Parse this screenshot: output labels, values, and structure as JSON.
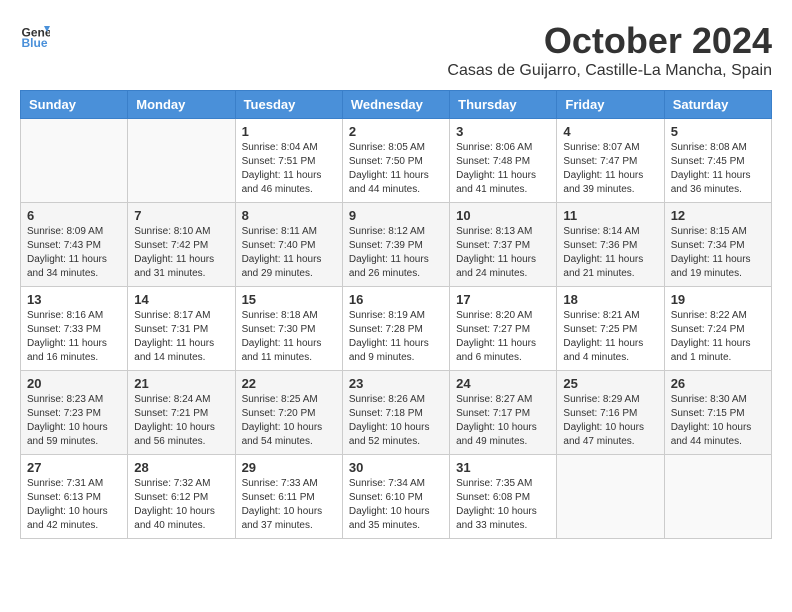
{
  "header": {
    "logo_line1": "General",
    "logo_line2": "Blue",
    "month_year": "October 2024",
    "location": "Casas de Guijarro, Castille-La Mancha, Spain"
  },
  "weekdays": [
    "Sunday",
    "Monday",
    "Tuesday",
    "Wednesday",
    "Thursday",
    "Friday",
    "Saturday"
  ],
  "weeks": [
    [
      {
        "num": "",
        "detail": ""
      },
      {
        "num": "",
        "detail": ""
      },
      {
        "num": "1",
        "detail": "Sunrise: 8:04 AM\nSunset: 7:51 PM\nDaylight: 11 hours and 46 minutes."
      },
      {
        "num": "2",
        "detail": "Sunrise: 8:05 AM\nSunset: 7:50 PM\nDaylight: 11 hours and 44 minutes."
      },
      {
        "num": "3",
        "detail": "Sunrise: 8:06 AM\nSunset: 7:48 PM\nDaylight: 11 hours and 41 minutes."
      },
      {
        "num": "4",
        "detail": "Sunrise: 8:07 AM\nSunset: 7:47 PM\nDaylight: 11 hours and 39 minutes."
      },
      {
        "num": "5",
        "detail": "Sunrise: 8:08 AM\nSunset: 7:45 PM\nDaylight: 11 hours and 36 minutes."
      }
    ],
    [
      {
        "num": "6",
        "detail": "Sunrise: 8:09 AM\nSunset: 7:43 PM\nDaylight: 11 hours and 34 minutes."
      },
      {
        "num": "7",
        "detail": "Sunrise: 8:10 AM\nSunset: 7:42 PM\nDaylight: 11 hours and 31 minutes."
      },
      {
        "num": "8",
        "detail": "Sunrise: 8:11 AM\nSunset: 7:40 PM\nDaylight: 11 hours and 29 minutes."
      },
      {
        "num": "9",
        "detail": "Sunrise: 8:12 AM\nSunset: 7:39 PM\nDaylight: 11 hours and 26 minutes."
      },
      {
        "num": "10",
        "detail": "Sunrise: 8:13 AM\nSunset: 7:37 PM\nDaylight: 11 hours and 24 minutes."
      },
      {
        "num": "11",
        "detail": "Sunrise: 8:14 AM\nSunset: 7:36 PM\nDaylight: 11 hours and 21 minutes."
      },
      {
        "num": "12",
        "detail": "Sunrise: 8:15 AM\nSunset: 7:34 PM\nDaylight: 11 hours and 19 minutes."
      }
    ],
    [
      {
        "num": "13",
        "detail": "Sunrise: 8:16 AM\nSunset: 7:33 PM\nDaylight: 11 hours and 16 minutes."
      },
      {
        "num": "14",
        "detail": "Sunrise: 8:17 AM\nSunset: 7:31 PM\nDaylight: 11 hours and 14 minutes."
      },
      {
        "num": "15",
        "detail": "Sunrise: 8:18 AM\nSunset: 7:30 PM\nDaylight: 11 hours and 11 minutes."
      },
      {
        "num": "16",
        "detail": "Sunrise: 8:19 AM\nSunset: 7:28 PM\nDaylight: 11 hours and 9 minutes."
      },
      {
        "num": "17",
        "detail": "Sunrise: 8:20 AM\nSunset: 7:27 PM\nDaylight: 11 hours and 6 minutes."
      },
      {
        "num": "18",
        "detail": "Sunrise: 8:21 AM\nSunset: 7:25 PM\nDaylight: 11 hours and 4 minutes."
      },
      {
        "num": "19",
        "detail": "Sunrise: 8:22 AM\nSunset: 7:24 PM\nDaylight: 11 hours and 1 minute."
      }
    ],
    [
      {
        "num": "20",
        "detail": "Sunrise: 8:23 AM\nSunset: 7:23 PM\nDaylight: 10 hours and 59 minutes."
      },
      {
        "num": "21",
        "detail": "Sunrise: 8:24 AM\nSunset: 7:21 PM\nDaylight: 10 hours and 56 minutes."
      },
      {
        "num": "22",
        "detail": "Sunrise: 8:25 AM\nSunset: 7:20 PM\nDaylight: 10 hours and 54 minutes."
      },
      {
        "num": "23",
        "detail": "Sunrise: 8:26 AM\nSunset: 7:18 PM\nDaylight: 10 hours and 52 minutes."
      },
      {
        "num": "24",
        "detail": "Sunrise: 8:27 AM\nSunset: 7:17 PM\nDaylight: 10 hours and 49 minutes."
      },
      {
        "num": "25",
        "detail": "Sunrise: 8:29 AM\nSunset: 7:16 PM\nDaylight: 10 hours and 47 minutes."
      },
      {
        "num": "26",
        "detail": "Sunrise: 8:30 AM\nSunset: 7:15 PM\nDaylight: 10 hours and 44 minutes."
      }
    ],
    [
      {
        "num": "27",
        "detail": "Sunrise: 7:31 AM\nSunset: 6:13 PM\nDaylight: 10 hours and 42 minutes."
      },
      {
        "num": "28",
        "detail": "Sunrise: 7:32 AM\nSunset: 6:12 PM\nDaylight: 10 hours and 40 minutes."
      },
      {
        "num": "29",
        "detail": "Sunrise: 7:33 AM\nSunset: 6:11 PM\nDaylight: 10 hours and 37 minutes."
      },
      {
        "num": "30",
        "detail": "Sunrise: 7:34 AM\nSunset: 6:10 PM\nDaylight: 10 hours and 35 minutes."
      },
      {
        "num": "31",
        "detail": "Sunrise: 7:35 AM\nSunset: 6:08 PM\nDaylight: 10 hours and 33 minutes."
      },
      {
        "num": "",
        "detail": ""
      },
      {
        "num": "",
        "detail": ""
      }
    ]
  ]
}
